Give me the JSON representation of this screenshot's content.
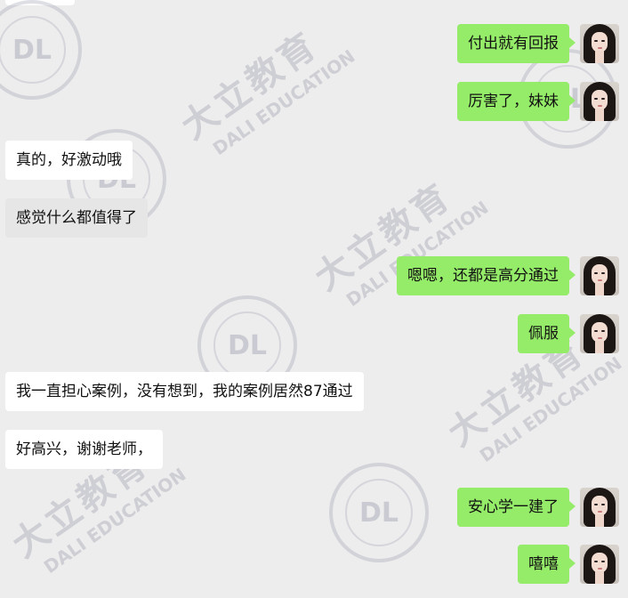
{
  "watermark": {
    "cn": "大立教育",
    "en": "DALI EDUCATION",
    "seal_glyph": "DL"
  },
  "messages": [
    {
      "side": "right",
      "text": "付出就有回报"
    },
    {
      "side": "right",
      "text": "厉害了，妹妹"
    },
    {
      "side": "left",
      "text": "真的，好激动哦"
    },
    {
      "side": "left",
      "text": "感觉什么都值得了"
    },
    {
      "side": "right",
      "text": "嗯嗯，还都是高分通过"
    },
    {
      "side": "right",
      "text": "佩服"
    },
    {
      "side": "left",
      "text": "我一直担心案例，没有想到，我的案例居然87通过"
    },
    {
      "side": "left",
      "text": "好高兴，谢谢老师，"
    },
    {
      "side": "right",
      "text": "安心学一建了"
    },
    {
      "side": "right",
      "text": "嘻嘻"
    }
  ]
}
